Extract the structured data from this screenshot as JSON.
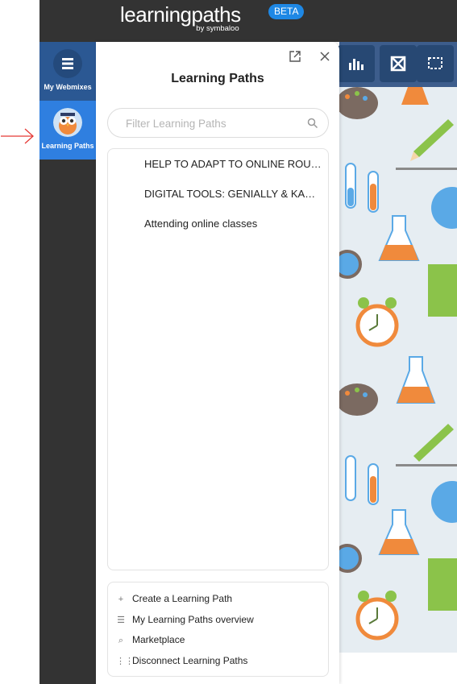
{
  "brand": {
    "name": "learningpaths",
    "sub": "by symbaloo",
    "badge": "BETA"
  },
  "sidebar": {
    "items": [
      {
        "label": "My Webmixes",
        "icon": "list-icon"
      },
      {
        "label": "Learning Paths",
        "icon": "owl-avatar-icon"
      }
    ]
  },
  "panel": {
    "title": "Learning Paths",
    "filter_placeholder": "Filter Learning Paths",
    "paths": [
      "HELP TO ADAPT TO ONLINE ROUTINE",
      "DIGITAL TOOLS: GENIALLY & KAHOOT",
      "Attending online classes"
    ],
    "actions": [
      {
        "label": "Create a Learning Path",
        "icon": "+"
      },
      {
        "label": "My Learning Paths overview",
        "icon": "☰"
      },
      {
        "label": "Marketplace",
        "icon": "⌕"
      },
      {
        "label": "Disconnect Learning Paths",
        "icon": "⋮⋮"
      }
    ]
  },
  "colors": {
    "header": "#333333",
    "accent": "#2f7fe0",
    "badge": "#1e88e5",
    "annotation": "#e53935"
  }
}
